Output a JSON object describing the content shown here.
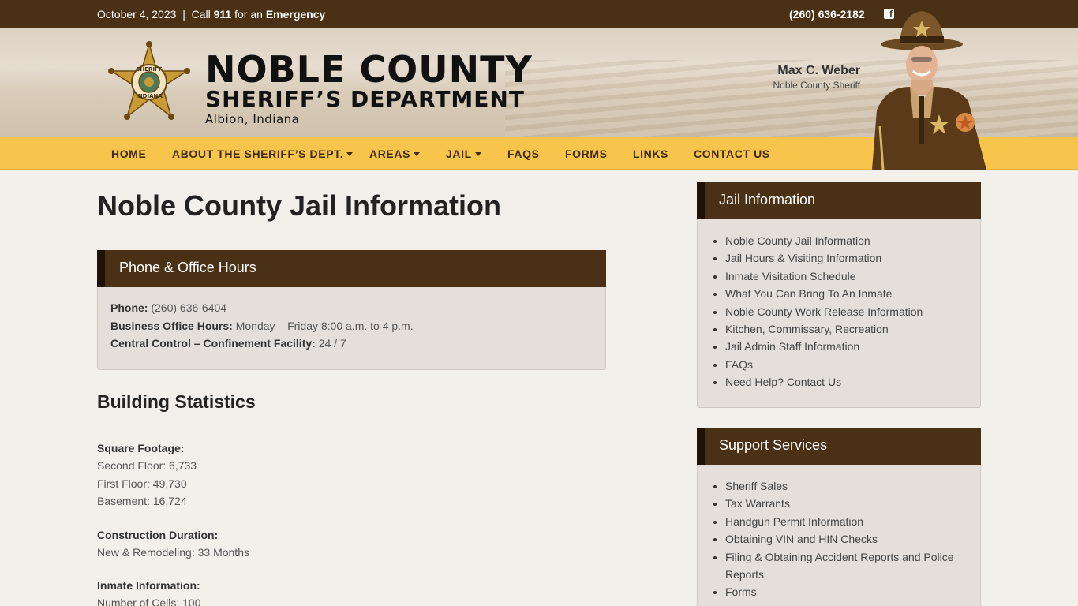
{
  "topbar": {
    "date": "October 4, 2023",
    "separator": "|",
    "call_prefix": "Call",
    "call_number": "911",
    "call_mid": "for an",
    "call_emergency": "Emergency",
    "phone": "(260) 636-2182",
    "facebook_icon": "facebook-icon"
  },
  "header": {
    "title_line1": "NOBLE COUNTY",
    "title_line2": "SHERIFF’S DEPARTMENT",
    "location": "Albion, Indiana",
    "badge_top_text": "SHERIFF",
    "badge_bottom_text": "INDIANA",
    "sheriff_name": "Max C. Weber",
    "sheriff_title": "Noble County Sheriff"
  },
  "nav": {
    "items": [
      {
        "label": "HOME",
        "dropdown": false
      },
      {
        "label": "ABOUT THE SHERIFF’S DEPT.",
        "dropdown": true
      },
      {
        "label": "AREAS",
        "dropdown": true
      },
      {
        "label": "JAIL",
        "dropdown": true
      },
      {
        "label": "FAQS",
        "dropdown": false
      },
      {
        "label": "FORMS",
        "dropdown": false
      },
      {
        "label": "LINKS",
        "dropdown": false
      },
      {
        "label": "CONTACT US",
        "dropdown": false
      }
    ]
  },
  "main": {
    "title": "Noble County Jail Information",
    "hours_panel": {
      "heading": "Phone & Office Hours",
      "phone_label": "Phone:",
      "phone_value": "(260) 636-6404",
      "office_label": "Business Office Hours:",
      "office_value": "Monday – Friday 8:00 a.m. to 4 p.m.",
      "control_label": "Central Control – Confinement Facility:",
      "control_value": "24 / 7"
    },
    "stats_heading": "Building Statistics",
    "square_footage": {
      "label": "Square Footage:",
      "second_floor": "Second Floor: 6,733",
      "first_floor": "First Floor: 49,730",
      "basement": "Basement: 16,724"
    },
    "construction": {
      "label": "Construction Duration:",
      "value": "New & Remodeling: 33 Months"
    },
    "inmate": {
      "label": "Inmate Information:",
      "cells": "Number of Cells: 100"
    }
  },
  "sidebar": {
    "jail_info": {
      "heading": "Jail Information",
      "items": [
        "Noble County Jail Information",
        "Jail Hours & Visiting Information",
        "Inmate Visitation Schedule",
        "What You Can Bring To An Inmate",
        "Noble County Work Release Information",
        "Kitchen, Commissary, Recreation",
        "Jail Admin Staff Information",
        "FAQs",
        "Need Help? Contact Us"
      ]
    },
    "support": {
      "heading": "Support Services",
      "items": [
        "Sheriff Sales",
        "Tax Warrants",
        "Handgun Permit Information",
        "Obtaining VIN and HIN Checks",
        "Filing & Obtaining Accident Reports and Police Reports",
        "Forms"
      ]
    }
  },
  "colors": {
    "topbar": "#4a3015",
    "nav": "#f7c44c",
    "panel_head": "#4a3015",
    "panel_body": "#e4dfdb",
    "page_bg": "#f3efeb"
  }
}
